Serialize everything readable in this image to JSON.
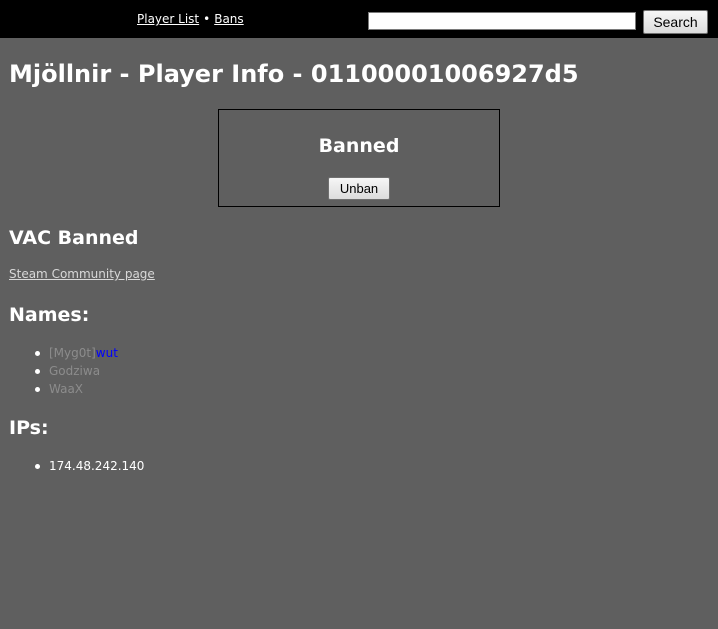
{
  "nav": {
    "player_list": "Player List",
    "separator": "•",
    "bans": "Bans"
  },
  "search": {
    "value": "",
    "button_label": "Search"
  },
  "page": {
    "title": "Mjöllnir - Player Info - 01100001006927d5"
  },
  "ban_box": {
    "status": "Banned",
    "unban_label": "Unban"
  },
  "vac_status": "VAC Banned",
  "steam_link": "Steam Community page",
  "names": {
    "heading": "Names:",
    "items": [
      {
        "prefix": "[Myg0t]",
        "highlight": "wut"
      },
      {
        "text": "Godziwa"
      },
      {
        "text": "WaaX"
      }
    ]
  },
  "ips": {
    "heading": "IPs:",
    "items": [
      "174.48.242.140"
    ]
  },
  "colors": {
    "background": "#5f5f5f",
    "topbar": "#000000",
    "muted_name": "#8c8c8c",
    "highlight_name": "#0000ff"
  }
}
